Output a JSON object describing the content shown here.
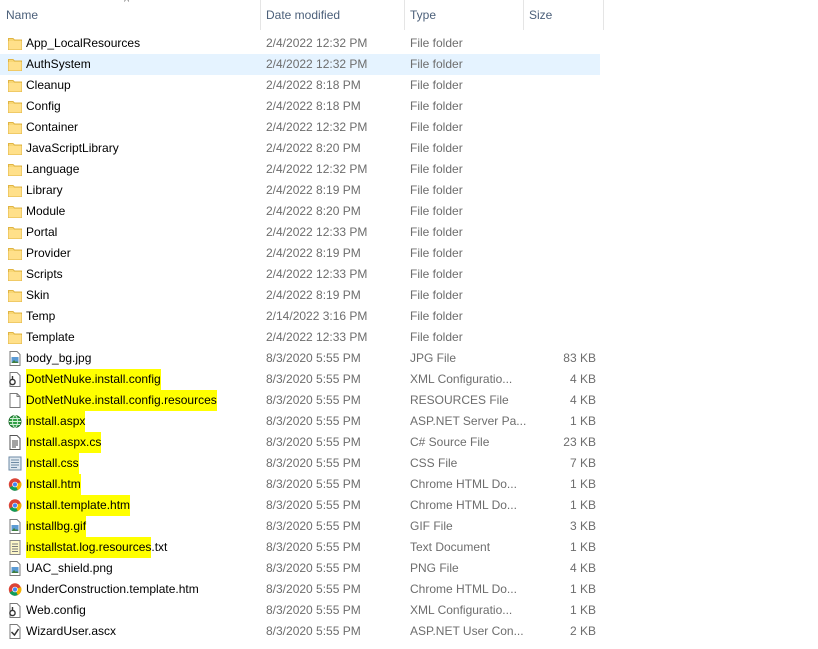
{
  "columns": {
    "name": "Name",
    "date": "Date modified",
    "type": "Type",
    "size": "Size"
  },
  "sort_indicator": "^",
  "rows": [
    {
      "name": "App_LocalResources",
      "date": "2/4/2022 12:32 PM",
      "type": "File folder",
      "size": "",
      "icon": "folder-icon"
    },
    {
      "name": "AuthSystem",
      "date": "2/4/2022 12:32 PM",
      "type": "File folder",
      "size": "",
      "icon": "folder-icon",
      "selected": true
    },
    {
      "name": "Cleanup",
      "date": "2/4/2022 8:18 PM",
      "type": "File folder",
      "size": "",
      "icon": "folder-icon"
    },
    {
      "name": "Config",
      "date": "2/4/2022 8:18 PM",
      "type": "File folder",
      "size": "",
      "icon": "folder-icon"
    },
    {
      "name": "Container",
      "date": "2/4/2022 12:32 PM",
      "type": "File folder",
      "size": "",
      "icon": "folder-icon"
    },
    {
      "name": "JavaScriptLibrary",
      "date": "2/4/2022 8:20 PM",
      "type": "File folder",
      "size": "",
      "icon": "folder-icon"
    },
    {
      "name": "Language",
      "date": "2/4/2022 12:32 PM",
      "type": "File folder",
      "size": "",
      "icon": "folder-icon"
    },
    {
      "name": "Library",
      "date": "2/4/2022 8:19 PM",
      "type": "File folder",
      "size": "",
      "icon": "folder-icon"
    },
    {
      "name": "Module",
      "date": "2/4/2022 8:20 PM",
      "type": "File folder",
      "size": "",
      "icon": "folder-icon"
    },
    {
      "name": "Portal",
      "date": "2/4/2022 12:33 PM",
      "type": "File folder",
      "size": "",
      "icon": "folder-icon"
    },
    {
      "name": "Provider",
      "date": "2/4/2022 8:19 PM",
      "type": "File folder",
      "size": "",
      "icon": "folder-icon"
    },
    {
      "name": "Scripts",
      "date": "2/4/2022 12:33 PM",
      "type": "File folder",
      "size": "",
      "icon": "folder-icon"
    },
    {
      "name": "Skin",
      "date": "2/4/2022 8:19 PM",
      "type": "File folder",
      "size": "",
      "icon": "folder-icon"
    },
    {
      "name": "Temp",
      "date": "2/14/2022 3:16 PM",
      "type": "File folder",
      "size": "",
      "icon": "folder-icon"
    },
    {
      "name": "Template",
      "date": "2/4/2022 12:33 PM",
      "type": "File folder",
      "size": "",
      "icon": "folder-icon"
    },
    {
      "name": "body_bg.jpg",
      "date": "8/3/2020 5:55 PM",
      "type": "JPG File",
      "size": "83 KB",
      "icon": "image-file-icon"
    },
    {
      "name": "DotNetNuke.install.config",
      "date": "8/3/2020 5:55 PM",
      "type": "XML Configuratio...",
      "size": "4 KB",
      "icon": "config-file-icon",
      "highlight": true
    },
    {
      "name": "DotNetNuke.install.config.resources",
      "date": "8/3/2020 5:55 PM",
      "type": "RESOURCES File",
      "size": "4 KB",
      "icon": "blank-file-icon",
      "highlight": true
    },
    {
      "name": "install.aspx",
      "date": "8/3/2020 5:55 PM",
      "type": "ASP.NET Server Pa...",
      "size": "1 KB",
      "icon": "globe-file-icon",
      "highlight": true
    },
    {
      "name": "Install.aspx.cs",
      "date": "8/3/2020 5:55 PM",
      "type": "C# Source File",
      "size": "23 KB",
      "icon": "code-file-icon",
      "highlight": true
    },
    {
      "name": "Install.css",
      "date": "8/3/2020 5:55 PM",
      "type": "CSS File",
      "size": "7 KB",
      "icon": "css-file-icon",
      "highlight": true
    },
    {
      "name": "Install.htm",
      "date": "8/3/2020 5:55 PM",
      "type": "Chrome HTML Do...",
      "size": "1 KB",
      "icon": "chrome-icon",
      "highlight": true
    },
    {
      "name": "Install.template.htm",
      "date": "8/3/2020 5:55 PM",
      "type": "Chrome HTML Do...",
      "size": "1 KB",
      "icon": "chrome-icon",
      "highlight": true
    },
    {
      "name": "installbg.gif",
      "date": "8/3/2020 5:55 PM",
      "type": "GIF File",
      "size": "3 KB",
      "icon": "image-file-icon",
      "highlight": true
    },
    {
      "name": "installstat.log.resources",
      "name_suffix": ".txt",
      "date": "8/3/2020 5:55 PM",
      "type": "Text Document",
      "size": "1 KB",
      "icon": "text-file-icon",
      "highlight": true
    },
    {
      "name": "UAC_shield.png",
      "date": "8/3/2020 5:55 PM",
      "type": "PNG File",
      "size": "4 KB",
      "icon": "image-file-icon"
    },
    {
      "name": "UnderConstruction.template.htm",
      "date": "8/3/2020 5:55 PM",
      "type": "Chrome HTML Do...",
      "size": "1 KB",
      "icon": "chrome-icon"
    },
    {
      "name": "Web.config",
      "date": "8/3/2020 5:55 PM",
      "type": "XML Configuratio...",
      "size": "1 KB",
      "icon": "config-file-icon"
    },
    {
      "name": "WizardUser.ascx",
      "date": "8/3/2020 5:55 PM",
      "type": "ASP.NET User Con...",
      "size": "2 KB",
      "icon": "control-file-icon"
    }
  ],
  "colors": {
    "highlight": "#ffff00",
    "selection": "#e5f3ff",
    "folder": "#f8d775",
    "header_text": "#4c607a"
  }
}
